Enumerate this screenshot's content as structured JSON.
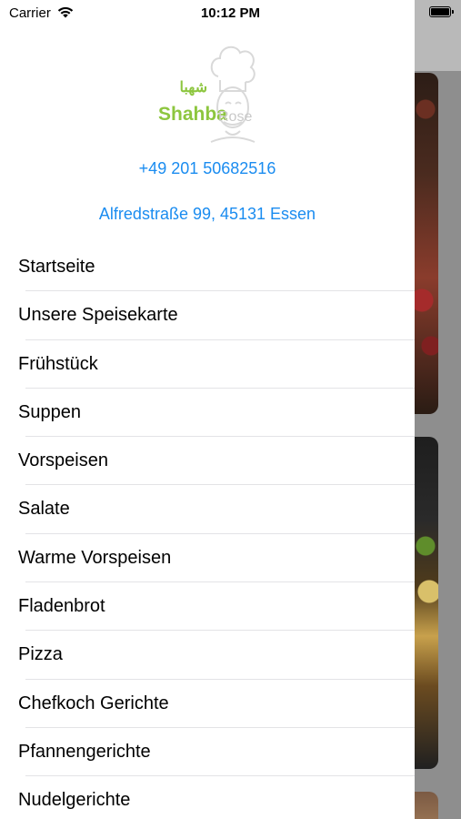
{
  "status_bar": {
    "carrier": "Carrier",
    "time": "10:12 PM"
  },
  "logo": {
    "arabic": "شهبا",
    "text": "Shahba",
    "text_faint": "Rose"
  },
  "contact": {
    "phone": "+49 201 50682516",
    "address": "Alfredstraße 99, 45131 Essen"
  },
  "menu": {
    "items": [
      {
        "label": "Startseite"
      },
      {
        "label": "Unsere Speisekarte"
      },
      {
        "label": "Frühstück"
      },
      {
        "label": "Suppen"
      },
      {
        "label": "Vorspeisen"
      },
      {
        "label": "Salate"
      },
      {
        "label": "Warme Vorspeisen"
      },
      {
        "label": "Fladenbrot"
      },
      {
        "label": "Pizza"
      },
      {
        "label": "Chefkoch Gerichte"
      },
      {
        "label": "Pfannengerichte"
      },
      {
        "label": "Nudelgerichte"
      }
    ]
  },
  "colors": {
    "link": "#1a8cf0",
    "brand_green": "#8dc63f",
    "separator": "#e3e3e6"
  },
  "icons": {
    "wifi": "wifi-icon",
    "battery": "battery-icon",
    "chef": "chef-hat-icon"
  }
}
